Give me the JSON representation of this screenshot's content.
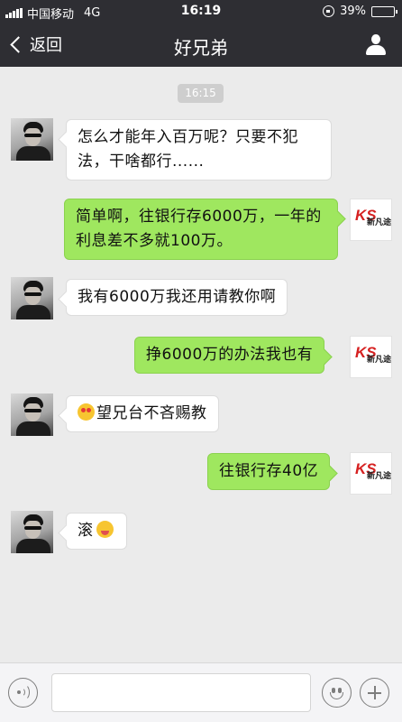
{
  "status_bar": {
    "carrier": "中国移动",
    "network": "4G",
    "time": "16:19",
    "battery_percent": "39%",
    "battery_level": 0.39,
    "icons": [
      "signal-icon",
      "rotation-lock-icon",
      "battery-icon"
    ]
  },
  "nav": {
    "back_label": "返回",
    "title": "好兄弟",
    "icons": [
      "back-chevron-icon",
      "profile-icon"
    ]
  },
  "chat": {
    "timestamp": "16:15",
    "messages": [
      {
        "side": "in",
        "text": "怎么才能年入百万呢？只要不犯法，干啥都行......"
      },
      {
        "side": "out",
        "text": "简单啊，往银行存6000万，一年的利息差不多就100万。"
      },
      {
        "side": "in",
        "text": "我有6000万我还用请教你啊"
      },
      {
        "side": "out",
        "text": "挣6000万的办法我也有"
      },
      {
        "side": "in",
        "text": "望兄台不吝赐教",
        "emoji": "heart-eyes-emoji"
      },
      {
        "side": "out",
        "text": "往银行存40亿"
      },
      {
        "side": "in",
        "text": "滚",
        "emoji": "yum-emoji"
      }
    ],
    "right_avatar_logo": {
      "mark": "KS",
      "text": "新凡途"
    }
  },
  "input_bar": {
    "placeholder": "",
    "icons": [
      "voice-icon",
      "emoji-icon",
      "plus-icon"
    ]
  },
  "colors": {
    "header_bg": "#2e2e33",
    "chat_bg": "#ebebeb",
    "outgoing_bubble": "#9fe75f",
    "incoming_bubble": "#ffffff"
  }
}
